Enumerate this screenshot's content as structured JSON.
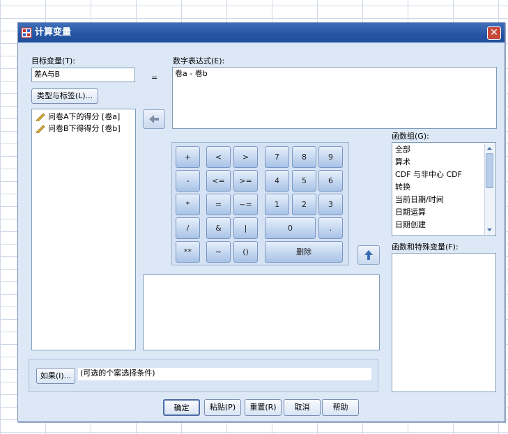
{
  "window": {
    "title": "计算变量",
    "close_glyph": "✕"
  },
  "target": {
    "label": "目标变量(T):",
    "value": "差A与B"
  },
  "equals": "=",
  "type_label_button": "类型与标签(L)...",
  "variables": [
    "问卷A下的得分 [卷a]",
    "问卷B下得得分 [卷b]"
  ],
  "expression": {
    "label": "数字表达式(E):",
    "value": "卷a - 卷b"
  },
  "keypad": {
    "ops": [
      "+",
      "<",
      ">",
      "-",
      "<=",
      ">=",
      "*",
      "=",
      "~=",
      "/",
      "&",
      "|",
      "**",
      "~",
      "()"
    ],
    "nums": [
      "7",
      "8",
      "9",
      "4",
      "5",
      "6",
      "1",
      "2",
      "3",
      "0",
      "."
    ],
    "delete": "删除"
  },
  "function_group": {
    "label": "函数组(G):",
    "items": [
      "全部",
      "算术",
      "CDF 与非中心 CDF",
      "转换",
      "当前日期/时间",
      "日期运算",
      "日期创建"
    ]
  },
  "functions_label": "函数和特殊变量(F):",
  "condition": {
    "if_button": "如果(I)...",
    "text": "(可选的个案选择条件)"
  },
  "footer": {
    "ok": "确定",
    "paste": "粘贴(P)",
    "reset": "重置(R)",
    "cancel": "取消",
    "help": "帮助"
  },
  "colors": {
    "titlebar": "#2656a3",
    "dialog_bg": "#dce8f6",
    "key_bg": "#a9c3e6",
    "close": "#c8483b"
  }
}
